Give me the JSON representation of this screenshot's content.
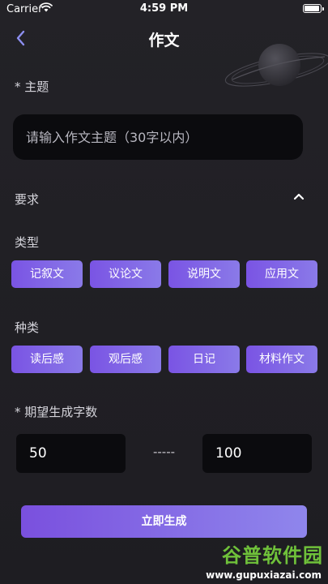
{
  "status_bar": {
    "carrier": "Carrier",
    "time": "4:59 PM"
  },
  "nav": {
    "title": "作文"
  },
  "topic": {
    "label": "* 主题",
    "placeholder": "请输入作文主题（30字以内）",
    "value": ""
  },
  "requirements": {
    "label": "要求",
    "expanded": true
  },
  "type_section": {
    "label": "类型",
    "options": [
      "记叙文",
      "议论文",
      "说明文",
      "应用文"
    ]
  },
  "category_section": {
    "label": "种类",
    "options": [
      "读后感",
      "观后感",
      "日记",
      "材料作文"
    ]
  },
  "word_count": {
    "label": "* 期望生成字数",
    "min": "50",
    "separator": "-----",
    "max": "100"
  },
  "actions": {
    "generate_label": "立即生成"
  },
  "watermark": {
    "line1": "谷普软件园",
    "line2": "www.gupuxiazai.com"
  },
  "colors": {
    "background": "#232227",
    "accent_start": "#7a54e4",
    "accent_end": "#8f86ec",
    "field_bg": "#0b0b0e"
  }
}
